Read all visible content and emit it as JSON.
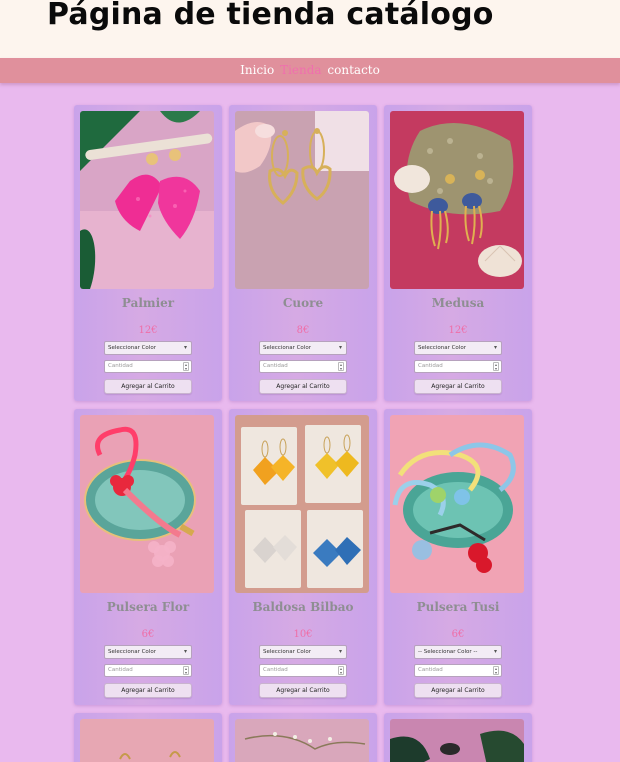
{
  "header": {
    "title": "Página de tienda catálogo"
  },
  "nav": {
    "items": [
      "Inicio",
      "Tienda",
      "contacto"
    ],
    "active": 1,
    "active_color": "#f06fae"
  },
  "colors": {
    "background": "#e9b9ee",
    "nav_bar": "#e0909c",
    "price": "#ef6fa8",
    "card": "#c9a3ea"
  },
  "card_controls": {
    "select_default": "Seleccionar Color",
    "select_alt": "-- Seleccionar Color --",
    "quantity_placeholder": "Cantidad",
    "add_button": "Agregar al Carrito"
  },
  "products": [
    {
      "name": "Palmier",
      "price": "12€",
      "select": "Seleccionar Color",
      "image": "pink monstera-leaf earrings"
    },
    {
      "name": "Cuore",
      "price": "8€",
      "select": "Seleccionar Color",
      "image": "gold heart hoop earrings"
    },
    {
      "name": "Medusa",
      "price": "12€",
      "select": "Seleccionar Color",
      "image": "blue jellyfish earrings with shells"
    },
    {
      "name": "Pulsera Flor",
      "price": "6€",
      "select": "Seleccionar Color",
      "image": "pink hair tie bracelet with flower"
    },
    {
      "name": "Baldosa Bilbao",
      "price": "10€",
      "select": "Seleccionar Color",
      "image": "tile pattern square earrings"
    },
    {
      "name": "Pulsera Tusi",
      "price": "6€",
      "select": "-- Seleccionar Color --",
      "image": "pastel hair tie bracelets with bears"
    }
  ]
}
